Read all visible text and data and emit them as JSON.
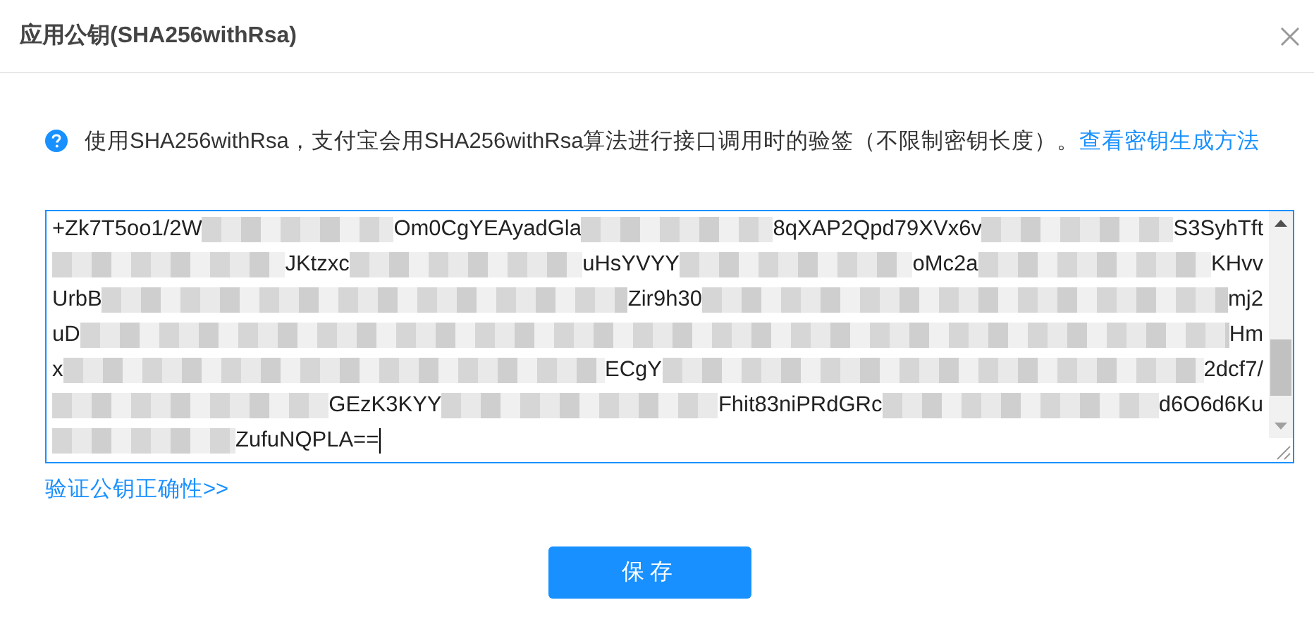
{
  "dialog": {
    "title": "应用公钥(SHA256withRsa)"
  },
  "notice": {
    "text": "使用SHA256withRsa，支付宝会用SHA256withRsa算法进行接口调用时的验签（不限制密钥长度）。",
    "link": "查看密钥生成方法"
  },
  "key_field": {
    "lines": [
      {
        "segments": [
          {
            "kind": "text",
            "text": "+Zk7T5oo1/2W"
          },
          {
            "kind": "hidden"
          },
          {
            "kind": "text",
            "text": "Om0CgYEAyadGla"
          },
          {
            "kind": "hidden"
          },
          {
            "kind": "text",
            "text": "8qXAP2Qpd79XVx6v"
          },
          {
            "kind": "hidden"
          },
          {
            "kind": "text",
            "text": "S3SyhTft"
          }
        ]
      },
      {
        "segments": [
          {
            "kind": "hidden"
          },
          {
            "kind": "text",
            "text": "JKtzxc"
          },
          {
            "kind": "hidden"
          },
          {
            "kind": "text",
            "text": "uHsYVYY"
          },
          {
            "kind": "hidden"
          },
          {
            "kind": "text",
            "text": "oMc2a"
          },
          {
            "kind": "hidden"
          },
          {
            "kind": "text",
            "text": "KHvv"
          }
        ]
      },
      {
        "segments": [
          {
            "kind": "text",
            "text": "UrbB"
          },
          {
            "kind": "hidden"
          },
          {
            "kind": "text",
            "text": "Zir9h30"
          },
          {
            "kind": "hidden"
          },
          {
            "kind": "text",
            "text": "mj2"
          }
        ]
      },
      {
        "segments": [
          {
            "kind": "text",
            "text": "uD"
          },
          {
            "kind": "hidden"
          },
          {
            "kind": "text",
            "text": "Hm"
          }
        ]
      },
      {
        "segments": [
          {
            "kind": "text",
            "text": "x"
          },
          {
            "kind": "hidden"
          },
          {
            "kind": "text",
            "text": "ECgY"
          },
          {
            "kind": "hidden"
          },
          {
            "kind": "text",
            "text": "2dcf7/"
          }
        ]
      },
      {
        "segments": [
          {
            "kind": "hidden"
          },
          {
            "kind": "text",
            "text": "GEzK3KYY"
          },
          {
            "kind": "hidden"
          },
          {
            "kind": "text",
            "text": "Fhit83niPRdGRc"
          },
          {
            "kind": "hidden"
          },
          {
            "kind": "text",
            "text": "d6O6d6Ku"
          }
        ]
      },
      {
        "segments": [
          {
            "kind": "hidden"
          },
          {
            "kind": "text",
            "text": "ZufuNQPLA=="
          }
        ]
      }
    ]
  },
  "verify_link": "验证公钥正确性>>",
  "buttons": [
    "保存"
  ]
}
